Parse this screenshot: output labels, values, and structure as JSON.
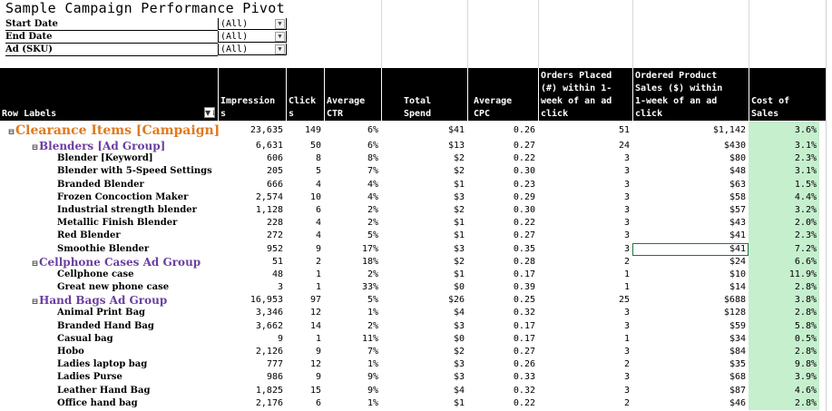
{
  "title": "Sample Campaign Performance Pivot",
  "filters": [
    {
      "label": "Start Date",
      "value": "(All)"
    },
    {
      "label": "End Date",
      "value": "(All)"
    },
    {
      "label": "Ad (SKU)",
      "value": "(All)"
    }
  ],
  "headers": {
    "row_labels": "Row Labels",
    "impressions": "Impression\ns",
    "clicks": "Click\ns",
    "avg_ctr": "Average\nCTR",
    "total_spend": "Total\nSpend",
    "avg_cpc": "Average\nCPC",
    "orders": "Orders Placed\n(#) within 1-\nweek of an ad\nclick",
    "sales": "Ordered Product\nSales ($) within\n1-week of an ad\nclick",
    "cos": "Cost of\nSales"
  },
  "rows": [
    {
      "level": 0,
      "toggle": "⊟",
      "label": "Clearance Items [Campaign]",
      "impr": "23,635",
      "clicks": "149",
      "ctr": "6%",
      "spend": "$41",
      "cpc": "0.26",
      "orders": "51",
      "sales": "$1,142",
      "cos": "3.6%"
    },
    {
      "level": 1,
      "toggle": "⊟",
      "label": "Blenders [Ad Group]",
      "impr": "6,631",
      "clicks": "50",
      "ctr": "6%",
      "spend": "$13",
      "cpc": "0.27",
      "orders": "24",
      "sales": "$430",
      "cos": "3.1%"
    },
    {
      "level": 2,
      "label": "Blender [Keyword]",
      "impr": "606",
      "clicks": "8",
      "ctr": "8%",
      "spend": "$2",
      "cpc": "0.22",
      "orders": "3",
      "sales": "$80",
      "cos": "2.3%"
    },
    {
      "level": 2,
      "label": "Blender with 5-Speed Settings",
      "impr": "205",
      "clicks": "5",
      "ctr": "7%",
      "spend": "$2",
      "cpc": "0.30",
      "orders": "3",
      "sales": "$48",
      "cos": "3.1%"
    },
    {
      "level": 2,
      "label": "Branded Blender",
      "impr": "666",
      "clicks": "4",
      "ctr": "4%",
      "spend": "$1",
      "cpc": "0.23",
      "orders": "3",
      "sales": "$63",
      "cos": "1.5%"
    },
    {
      "level": 2,
      "label": "Frozen Concoction Maker",
      "impr": "2,574",
      "clicks": "10",
      "ctr": "4%",
      "spend": "$3",
      "cpc": "0.29",
      "orders": "3",
      "sales": "$58",
      "cos": "4.4%"
    },
    {
      "level": 2,
      "label": "Industrial strength blender",
      "impr": "1,128",
      "clicks": "6",
      "ctr": "2%",
      "spend": "$2",
      "cpc": "0.30",
      "orders": "3",
      "sales": "$57",
      "cos": "3.2%"
    },
    {
      "level": 2,
      "label": "Metallic Finish Blender",
      "impr": "228",
      "clicks": "4",
      "ctr": "2%",
      "spend": "$1",
      "cpc": "0.22",
      "orders": "3",
      "sales": "$43",
      "cos": "2.0%"
    },
    {
      "level": 2,
      "label": "Red Blender",
      "impr": "272",
      "clicks": "4",
      "ctr": "5%",
      "spend": "$1",
      "cpc": "0.27",
      "orders": "3",
      "sales": "$41",
      "cos": "2.3%"
    },
    {
      "level": 2,
      "label": "Smoothie Blender",
      "impr": "952",
      "clicks": "9",
      "ctr": "17%",
      "spend": "$3",
      "cpc": "0.35",
      "orders": "3",
      "sales": "$41",
      "cos": "7.2%"
    },
    {
      "level": 1,
      "toggle": "⊟",
      "label": "Cellphone Cases Ad Group",
      "impr": "51",
      "clicks": "2",
      "ctr": "18%",
      "spend": "$2",
      "cpc": "0.28",
      "orders": "2",
      "sales": "$24",
      "cos": "6.6%"
    },
    {
      "level": 2,
      "label": "Cellphone case",
      "impr": "48",
      "clicks": "1",
      "ctr": "2%",
      "spend": "$1",
      "cpc": "0.17",
      "orders": "1",
      "sales": "$10",
      "cos": "11.9%"
    },
    {
      "level": 2,
      "label": "Great new phone case",
      "impr": "3",
      "clicks": "1",
      "ctr": "33%",
      "spend": "$0",
      "cpc": "0.39",
      "orders": "1",
      "sales": "$14",
      "cos": "2.8%"
    },
    {
      "level": 1,
      "toggle": "⊟",
      "label": "Hand Bags Ad Group",
      "impr": "16,953",
      "clicks": "97",
      "ctr": "5%",
      "spend": "$26",
      "cpc": "0.25",
      "orders": "25",
      "sales": "$688",
      "cos": "3.8%"
    },
    {
      "level": 2,
      "label": "Animal Print Bag",
      "impr": "3,346",
      "clicks": "12",
      "ctr": "1%",
      "spend": "$4",
      "cpc": "0.32",
      "orders": "3",
      "sales": "$128",
      "cos": "2.8%"
    },
    {
      "level": 2,
      "label": "Branded Hand Bag",
      "impr": "3,662",
      "clicks": "14",
      "ctr": "2%",
      "spend": "$3",
      "cpc": "0.17",
      "orders": "3",
      "sales": "$59",
      "cos": "5.8%"
    },
    {
      "level": 2,
      "label": "Casual bag",
      "impr": "9",
      "clicks": "1",
      "ctr": "11%",
      "spend": "$0",
      "cpc": "0.17",
      "orders": "1",
      "sales": "$34",
      "cos": "0.5%"
    },
    {
      "level": 2,
      "label": "Hobo",
      "impr": "2,126",
      "clicks": "9",
      "ctr": "7%",
      "spend": "$2",
      "cpc": "0.27",
      "orders": "3",
      "sales": "$84",
      "cos": "2.8%"
    },
    {
      "level": 2,
      "label": "Ladies laptop bag",
      "impr": "777",
      "clicks": "12",
      "ctr": "1%",
      "spend": "$3",
      "cpc": "0.26",
      "orders": "2",
      "sales": "$35",
      "cos": "9.8%"
    },
    {
      "level": 2,
      "label": "Ladies Purse",
      "impr": "986",
      "clicks": "9",
      "ctr": "9%",
      "spend": "$3",
      "cpc": "0.33",
      "orders": "3",
      "sales": "$68",
      "cos": "3.9%"
    },
    {
      "level": 2,
      "label": "Leather Hand Bag",
      "impr": "1,825",
      "clicks": "15",
      "ctr": "9%",
      "spend": "$4",
      "cpc": "0.32",
      "orders": "3",
      "sales": "$87",
      "cos": "4.6%"
    },
    {
      "level": 2,
      "label": "Office hand bag",
      "impr": "2,176",
      "clicks": "6",
      "ctr": "1%",
      "spend": "$1",
      "cpc": "0.22",
      "orders": "2",
      "sales": "$46",
      "cos": "2.8%"
    }
  ],
  "colors": {
    "campaign": "#e07a1e",
    "adgroup": "#6a3ea1",
    "cos_fill": "#c6efce",
    "header_bg": "#000000"
  },
  "icons": {
    "collapse": "minus-box-icon",
    "filter_dropdown": "dropdown-arrow-icon",
    "sort": "sort-filter-icon"
  }
}
